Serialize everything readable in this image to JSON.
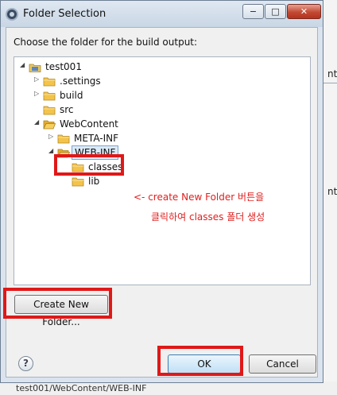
{
  "window": {
    "title": "Folder Selection"
  },
  "titlebar": {
    "minimize": "−",
    "maximize": "□",
    "close": "✕"
  },
  "prompt": "Choose the folder for the build output:",
  "tree": {
    "items": [
      {
        "label": "test001",
        "arrow": "◢",
        "icon": "project-icon"
      },
      {
        "label": ".settings",
        "arrow": "▷",
        "icon": "folder-icon"
      },
      {
        "label": "build",
        "arrow": "▷",
        "icon": "folder-icon"
      },
      {
        "label": "src",
        "arrow": "",
        "icon": "folder-icon"
      },
      {
        "label": "WebContent",
        "arrow": "◢",
        "icon": "folder-open-icon"
      },
      {
        "label": "META-INF",
        "arrow": "▷",
        "icon": "folder-icon"
      },
      {
        "label": "WEB-INF",
        "arrow": "◢",
        "icon": "folder-open-icon"
      },
      {
        "label": "classes",
        "arrow": "",
        "icon": "folder-icon"
      },
      {
        "label": "lib",
        "arrow": "",
        "icon": "folder-icon"
      }
    ]
  },
  "annotation": {
    "line1": "<-   create New Folder 버튼을",
    "line2": "클릭하여 classes 폴더 생성"
  },
  "buttons": {
    "create_new_folder": "Create New Folder...",
    "ok": "OK",
    "cancel": "Cancel",
    "help": "?"
  },
  "background": {
    "right_text_1": "nt",
    "right_text_2": "nt",
    "bottom_status": "test001/WebContent/WEB-INF"
  },
  "colors": {
    "annotation_red": "#e01818",
    "selection_blue": "#dceaf7",
    "folder_yellow": "#f3c34a"
  }
}
